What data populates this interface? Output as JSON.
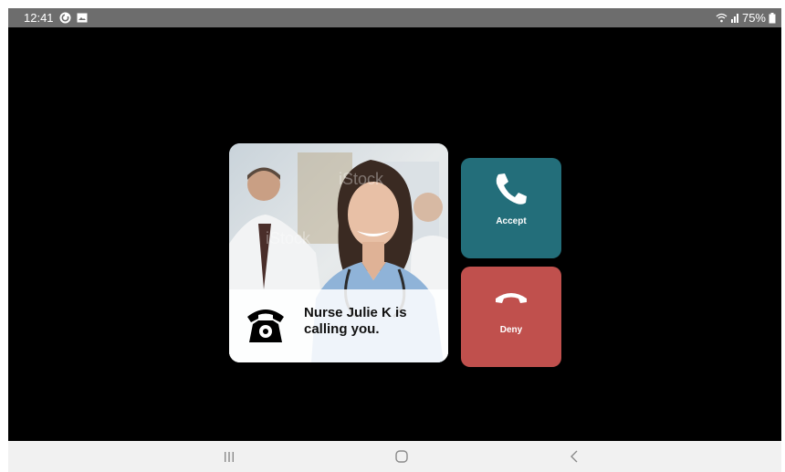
{
  "status_bar": {
    "time": "12:41",
    "battery": "75%",
    "left_icons": [
      "sync-icon",
      "image-icon"
    ],
    "right_icons": [
      "wifi-icon",
      "signal-icon",
      "battery-icon"
    ]
  },
  "call": {
    "caller_message": "Nurse Julie K is\ncalling you.",
    "photo_watermark": "iStock",
    "caption_icon": "telephone-icon"
  },
  "actions": {
    "accept_label": "Accept",
    "deny_label": "Deny",
    "accept_icon": "phone-handset-icon",
    "deny_icon": "hang-up-icon"
  },
  "colors": {
    "accept": "#236e7a",
    "deny": "#c0504d",
    "background": "#000000",
    "status_bar": "#6d6d6d",
    "nav_bar": "#f1f1f1"
  },
  "nav_bar": {
    "buttons": [
      "recent-apps-icon",
      "home-icon",
      "back-icon"
    ]
  }
}
